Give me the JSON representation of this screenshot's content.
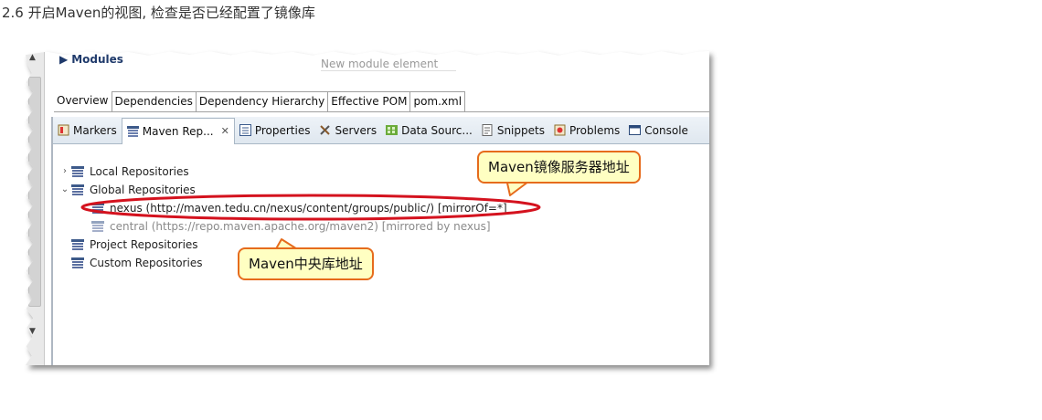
{
  "heading": "2.6 开启Maven的视图, 检查是否已经配置了镜像库",
  "editor": {
    "modules_label": "Modules",
    "new_module_placeholder": "New module element",
    "tabs": [
      "Overview",
      "Dependencies",
      "Dependency Hierarchy",
      "Effective POM",
      "pom.xml"
    ]
  },
  "views": {
    "tabs": [
      {
        "label": "Markers",
        "icon": "markers-icon"
      },
      {
        "label": "Maven Rep...",
        "icon": "maven-repo-icon",
        "active": true
      },
      {
        "label": "Properties",
        "icon": "properties-icon"
      },
      {
        "label": "Servers",
        "icon": "servers-icon"
      },
      {
        "label": "Data Sourc...",
        "icon": "data-source-icon"
      },
      {
        "label": "Snippets",
        "icon": "snippets-icon"
      },
      {
        "label": "Problems",
        "icon": "problems-icon"
      },
      {
        "label": "Console",
        "icon": "console-icon"
      }
    ],
    "close_glyph": "✕"
  },
  "tree": {
    "local": "Local Repositories",
    "global": "Global Repositories",
    "nexus": "nexus (http://maven.tedu.cn/nexus/content/groups/public/) [mirrorOf=*]",
    "central": "central (https://repo.maven.apache.org/maven2) [mirrored by nexus]",
    "project": "Project Repositories",
    "custom": "Custom Repositories"
  },
  "callouts": {
    "mirror": "Maven镜像服务器地址",
    "central": "Maven中央库地址"
  },
  "colors": {
    "callout_fill": "#ffffc2",
    "callout_border": "#e66b1c",
    "highlight_ellipse": "#d4121e"
  }
}
